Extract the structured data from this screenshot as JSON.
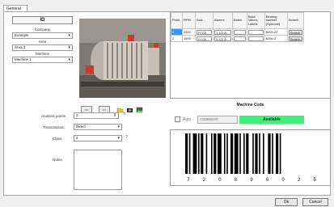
{
  "tab": {
    "general": "General"
  },
  "left": {
    "id_label": "ID",
    "company_label": "Company",
    "company_value": "Example",
    "area_label": "Area",
    "area_value": "Area 3",
    "machine_label": "Machine",
    "machine_value": "Machine 1"
  },
  "photo_buttons": {
    "prev": "<<",
    "next": ">>"
  },
  "form": {
    "analysis_points_label": "Analysis points",
    "analysis_points_value": "3",
    "transmission_label": "Transmission",
    "transmission_value": "Direct",
    "class_label": "Class",
    "class_value": "4",
    "notes_label": "Notes",
    "help_mark": "?"
  },
  "grid": {
    "headers": [
      "Point",
      "RPM",
      "Axis",
      "Alarms",
      "Notes",
      "Base Values Labels",
      "Bearing number (Optional)",
      "Search"
    ],
    "rows": [
      [
        "1",
        "1500",
        "H.V.A",
        "1.1/2.2/...",
        "...",
        "...",
        "6205-2Z",
        "Search"
      ],
      [
        "2",
        "1500",
        "H.V.A",
        "1.1/2.2/...",
        "...",
        "...",
        "6206-Z",
        "Search"
      ]
    ]
  },
  "machine_code": {
    "title": "Machine Code",
    "auto_label": "Auto",
    "code_value": "720896025",
    "status": "Available",
    "digits": [
      "7",
      "2",
      "0",
      "8",
      "9",
      "6",
      "0",
      "2",
      "5"
    ]
  },
  "footer": {
    "ok": "Ok",
    "cancel": "Cancel"
  },
  "colors": {
    "available": "#3cf07a",
    "selected_row": "#3399ff",
    "help": "#1f3fbf"
  }
}
